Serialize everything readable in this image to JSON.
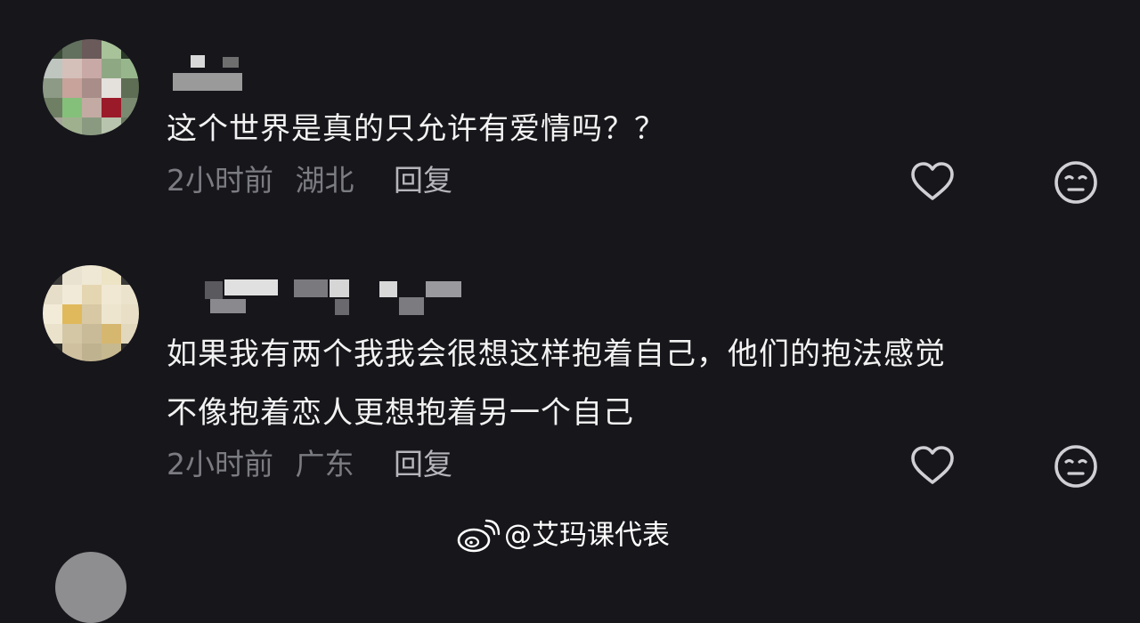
{
  "comments": [
    {
      "text_lines": [
        "这个世界是真的只允许有爱情吗？？"
      ],
      "time": "2小时前",
      "location": "湖北",
      "reply_label": "回复",
      "like_icon": "heart-outline-icon",
      "react_icon": "meh-face-icon"
    },
    {
      "text_lines": [
        "如果我有两个我我会很想这样抱着自己，他们的抱法感觉",
        "不像抱着恋人更想抱着另一个自己"
      ],
      "time": "2小时前",
      "location": "广东",
      "reply_label": "回复",
      "like_icon": "heart-outline-icon",
      "react_icon": "meh-face-icon"
    }
  ],
  "watermark": {
    "text": "@艾玛课代表",
    "logo_icon": "weibo-logo"
  },
  "colors": {
    "background": "#16161b",
    "text": "#f2f2f2",
    "meta": "#7b7b82",
    "reply": "#b5b5bb",
    "icon": "#cfcfd4"
  }
}
